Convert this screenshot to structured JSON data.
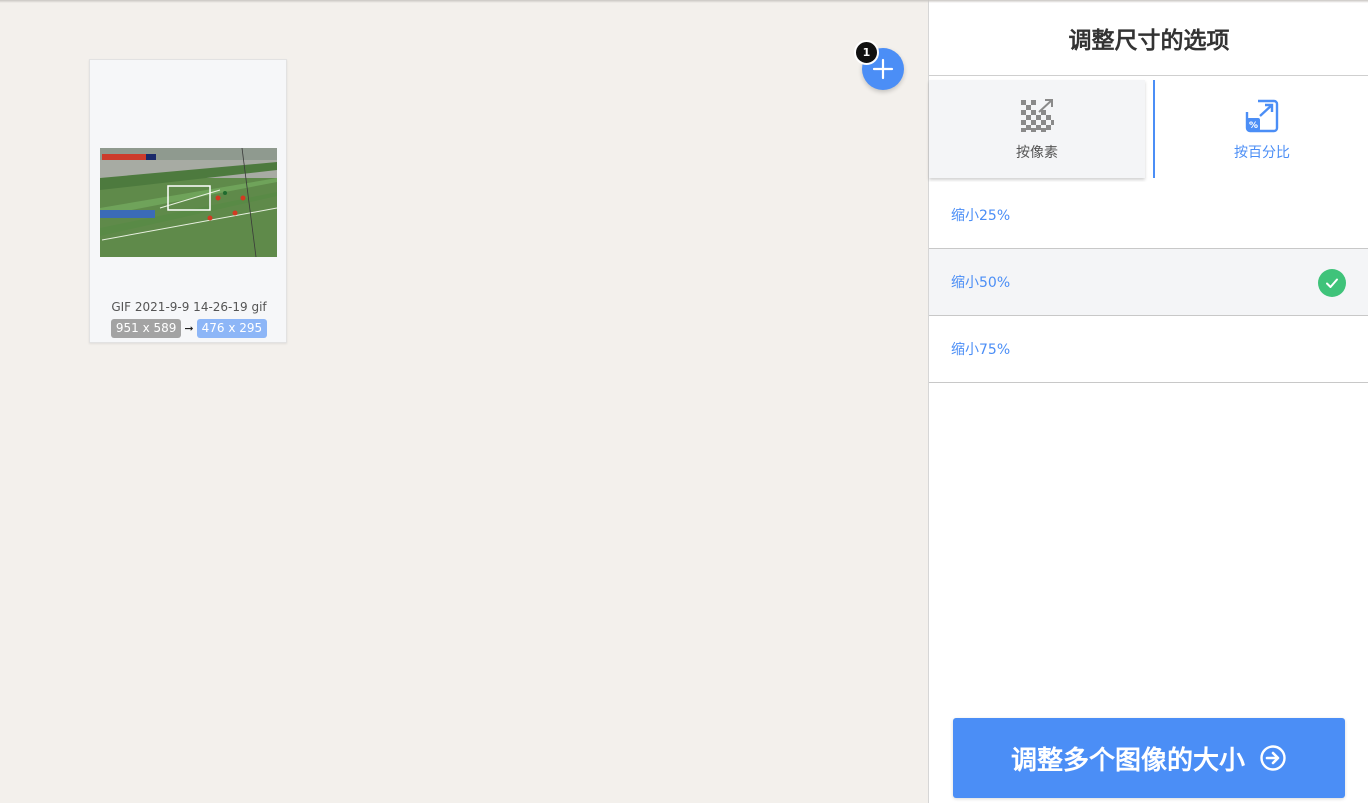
{
  "workspace": {
    "file": {
      "name": "GIF 2021-9-9 14-26-19 gif",
      "original_size": "951 x 589",
      "new_size": "476 x 295",
      "arrow": "➞"
    },
    "add_button_icon": "plus-icon",
    "file_count": "1"
  },
  "panel": {
    "title": "调整尺寸的选项",
    "tabs": [
      {
        "label": "按像素",
        "icon": "pixel-resize-icon",
        "active": false
      },
      {
        "label": "按百分比",
        "icon": "percent-resize-icon",
        "active": true
      }
    ],
    "options": [
      {
        "label": "缩小25%",
        "selected": false
      },
      {
        "label": "缩小50%",
        "selected": true
      },
      {
        "label": "缩小75%",
        "selected": false
      }
    ],
    "resize_button": {
      "label": "调整多个图像的大小",
      "icon": "arrow-circle-right-icon"
    }
  },
  "colors": {
    "accent": "#4b8ef6",
    "check": "#3fc37a",
    "workspace_bg": "#f3f0ec"
  }
}
